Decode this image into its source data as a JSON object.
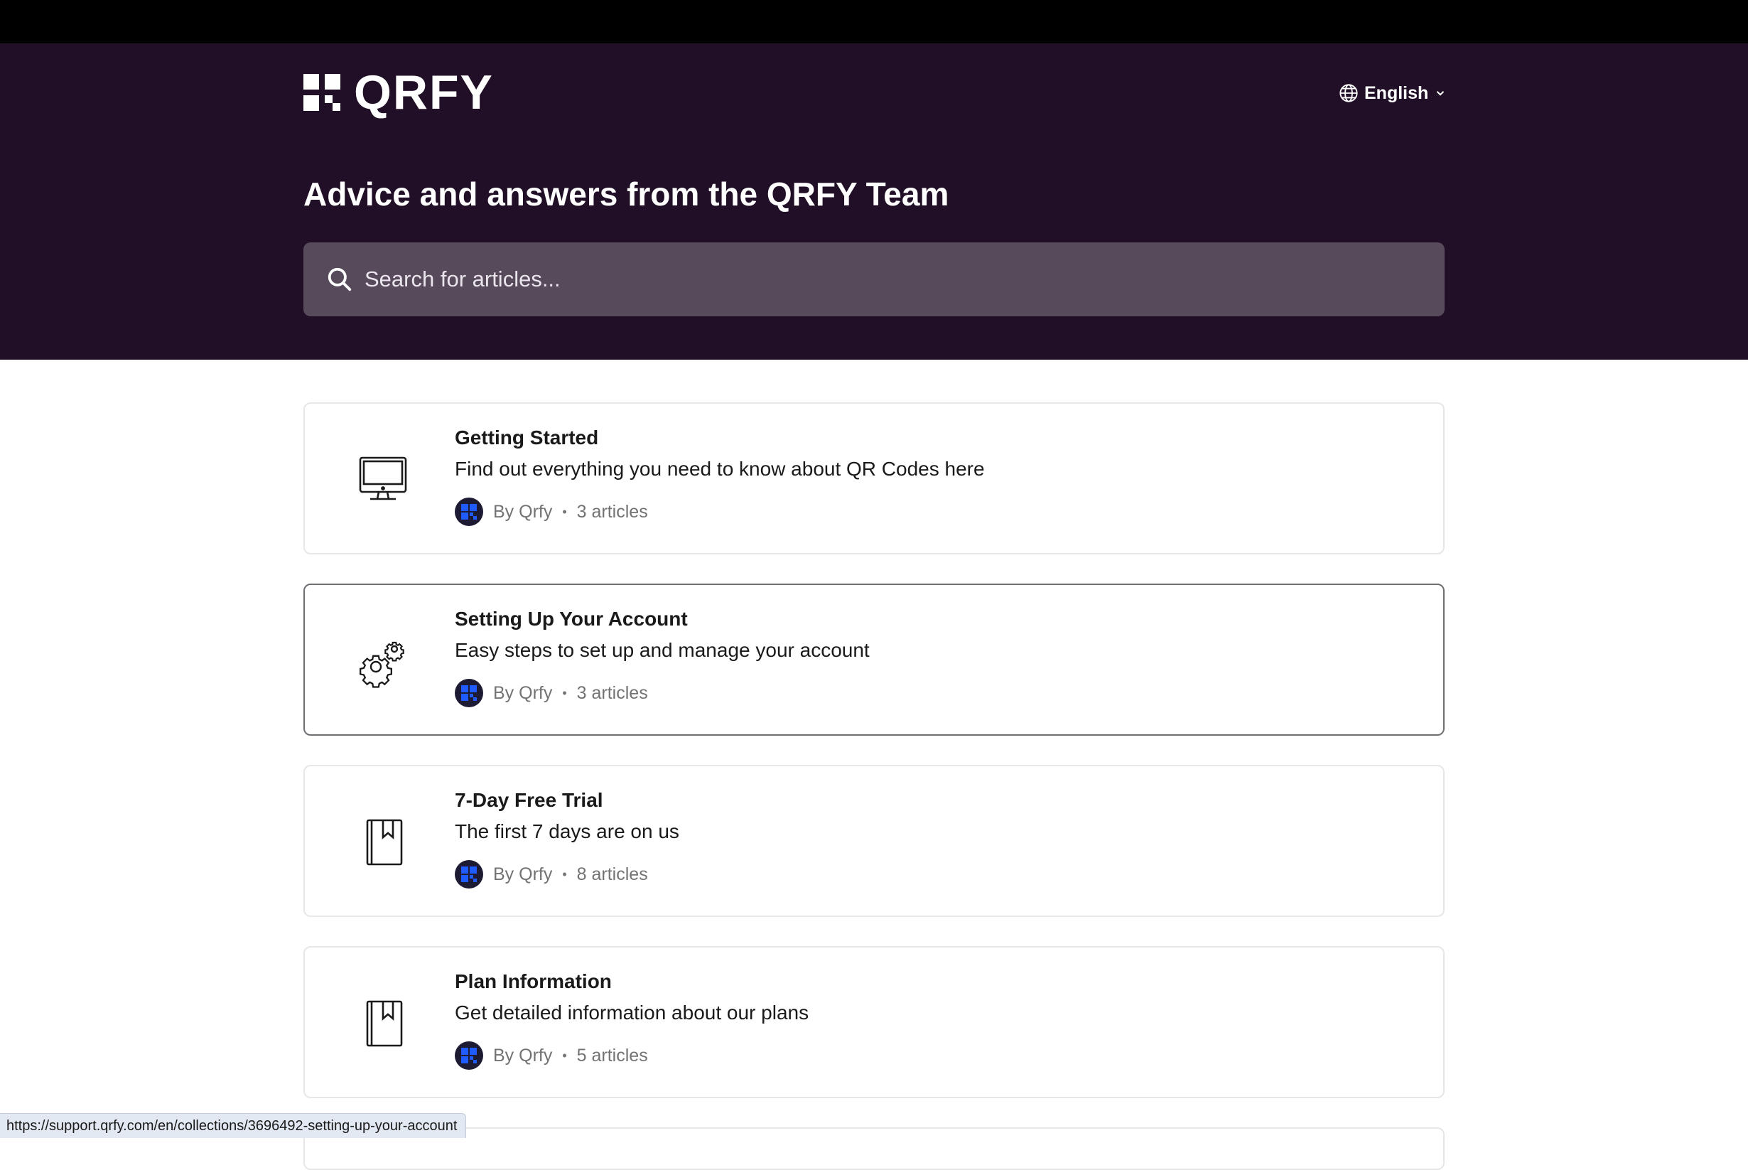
{
  "header": {
    "logo_text": "QRFY",
    "language": "English",
    "title": "Advice and answers from the QRFY Team"
  },
  "search": {
    "placeholder": "Search for articles..."
  },
  "collections": [
    {
      "title": "Getting Started",
      "description": "Find out everything you need to know about QR Codes here",
      "author": "By Qrfy",
      "separator": "•",
      "count": "3 articles",
      "icon": "monitor-icon"
    },
    {
      "title": "Setting Up Your Account",
      "description": "Easy steps to set up and manage your account",
      "author": "By Qrfy",
      "separator": "•",
      "count": "3 articles",
      "icon": "gears-icon"
    },
    {
      "title": "7-Day Free Trial",
      "description": "The first 7 days are on us",
      "author": "By Qrfy",
      "separator": "•",
      "count": "8 articles",
      "icon": "bookmark-book-icon"
    },
    {
      "title": "Plan Information",
      "description": "Get detailed information about our plans",
      "author": "By Qrfy",
      "separator": "•",
      "count": "5 articles",
      "icon": "bookmark-book-icon"
    }
  ],
  "status_bar": {
    "url": "https://support.qrfy.com/en/collections/3696492-setting-up-your-account"
  },
  "colors": {
    "hero_background": "#200f26",
    "search_background": "#574a5b",
    "avatar_accent": "#1f5bff"
  }
}
